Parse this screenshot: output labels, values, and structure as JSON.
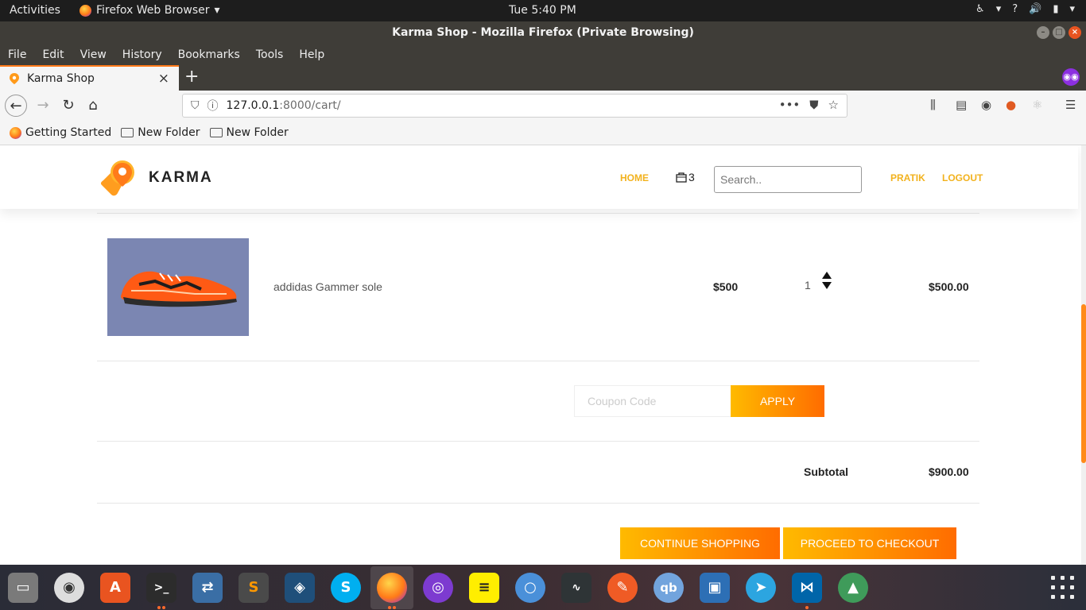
{
  "gnome_bar": {
    "activities": "Activities",
    "app_name": "Firefox Web Browser",
    "clock": "Tue  5:40 PM",
    "help": "?"
  },
  "window": {
    "title": "Karma Shop - Mozilla Firefox (Private Browsing)"
  },
  "menu": [
    "File",
    "Edit",
    "View",
    "History",
    "Bookmarks",
    "Tools",
    "Help"
  ],
  "tab": {
    "title": "Karma Shop"
  },
  "url": {
    "host": "127.0.0.1",
    "rest": ":8000/cart/",
    "more": "•••"
  },
  "bookmarks": [
    "Getting Started",
    "New Folder",
    "New Folder"
  ],
  "site": {
    "brand": "KARMA",
    "nav": {
      "home": "HOME",
      "cart_count": "3",
      "user": "PRATIK",
      "logout": "LOGOUT"
    },
    "search_placeholder": "Search.."
  },
  "cart": {
    "items": [
      {
        "name": "addidas Gammer sole",
        "price": "$500",
        "quantity": "1",
        "total": "$500.00"
      }
    ],
    "coupon_placeholder": "Coupon Code",
    "apply_label": "APPLY",
    "subtotal_label": "Subtotal",
    "subtotal_value": "$900.00",
    "continue_label": "CONTINUE SHOPPING",
    "checkout_label": "PROCEED TO CHECKOUT"
  },
  "colors": {
    "accent_start": "#ffba00",
    "accent_end": "#ff6c00",
    "nav_link": "#f2b21d"
  },
  "dock": {
    "apps": [
      "files",
      "rhythmbox",
      "software-center",
      "terminal",
      "network-manager",
      "sublime-text",
      "mysql-workbench",
      "skype",
      "firefox",
      "tor-browser",
      "notes",
      "chromium",
      "system-monitor",
      "postman",
      "qbittorrent",
      "screenshot",
      "telegram",
      "vscode",
      "rocket"
    ]
  }
}
